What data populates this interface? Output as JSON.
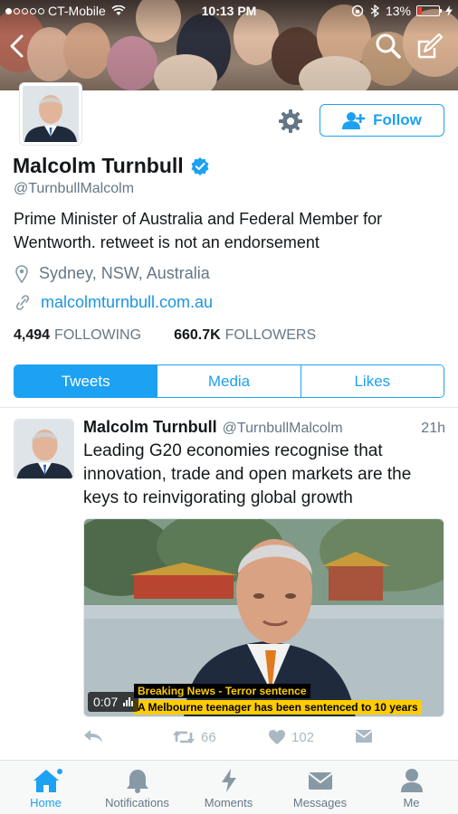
{
  "status_bar": {
    "carrier": "CT-Mobile",
    "time": "10:13 PM",
    "battery": "13%"
  },
  "icons": {
    "back": "chevron-left-icon",
    "search": "search-icon",
    "compose": "compose-icon",
    "settings": "gear-icon",
    "follow": "add-user-icon",
    "verified": "verified-badge-icon",
    "location": "location-pin-icon",
    "link": "link-icon"
  },
  "profile": {
    "name": "Malcolm Turnbull",
    "handle": "@TurnbullMalcolm",
    "bio": "Prime Minister of Australia and Federal Member for Wentworth. retweet is not an endorsement",
    "location": "Sydney, NSW, Australia",
    "website": "malcolmturnbull.com.au",
    "follow_label": "Follow",
    "following_count": "4,494",
    "following_label": "FOLLOWING",
    "followers_count": "660.7K",
    "followers_label": "FOLLOWERS"
  },
  "tabs": [
    {
      "label": "Tweets",
      "active": true
    },
    {
      "label": "Media",
      "active": false
    },
    {
      "label": "Likes",
      "active": false
    }
  ],
  "tweet": {
    "name": "Malcolm Turnbull",
    "handle": "@TurnbullMalcolm",
    "time": "21h",
    "text": "Leading G20 economies recognise that innovation, trade and open markets are the keys to reinvigorating global growth",
    "media": {
      "duration": "0:07",
      "ticker_headline": "Breaking News - Terror sentence",
      "ticker_text": "A Melbourne teenager has been sentenced to 10 years"
    },
    "actions": {
      "retweets": "66",
      "likes": "102"
    }
  },
  "colors": {
    "accent": "#1da1f2",
    "text": "#14171a",
    "muted": "#657786",
    "link": "#1b95e0"
  },
  "tab_bar": [
    {
      "label": "Home",
      "icon": "home-icon",
      "active": true
    },
    {
      "label": "Notifications",
      "icon": "bell-icon",
      "active": false
    },
    {
      "label": "Moments",
      "icon": "lightning-icon",
      "active": false
    },
    {
      "label": "Messages",
      "icon": "envelope-icon",
      "active": false
    },
    {
      "label": "Me",
      "icon": "person-icon",
      "active": false
    }
  ]
}
